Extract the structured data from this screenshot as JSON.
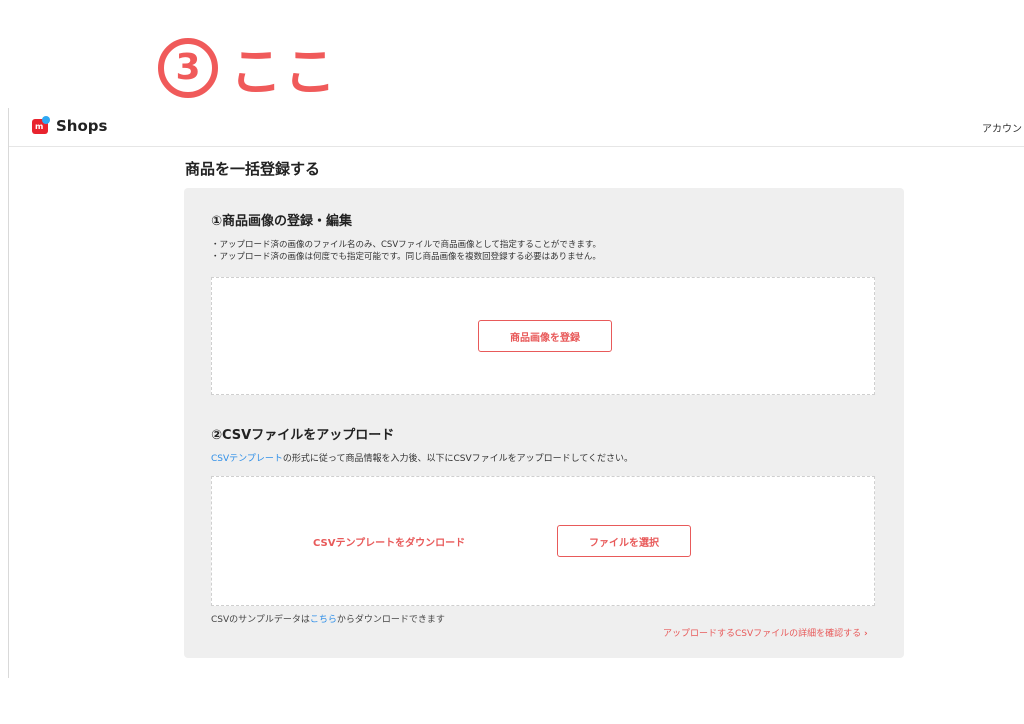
{
  "annotation": {
    "number": "3",
    "text": "ここ"
  },
  "header": {
    "logo_text": "Shops",
    "account_label": "アカウント"
  },
  "page": {
    "title": "商品を一括登録する"
  },
  "section_images": {
    "title": "①商品画像の登録・編集",
    "notes": [
      "・アップロード済の画像のファイル名のみ、CSVファイルで商品画像として指定することができます。",
      "・アップロード済の画像は何度でも指定可能です。同じ商品画像を複数回登録する必要はありません。"
    ],
    "register_button": "商品画像を登録"
  },
  "section_csv": {
    "title": "②CSVファイルをアップロード",
    "description_link": "CSVテンプレート",
    "description_rest": "の形式に従って商品情報を入力後、以下にCSVファイルをアップロードしてください。",
    "download_template_link": "CSVテンプレートをダウンロード",
    "select_file_button": "ファイルを選択",
    "sample_prefix": "CSVのサンプルデータは",
    "sample_link": "こちら",
    "sample_suffix": "からダウンロードできます",
    "detail_link": "アップロードするCSVファイルの詳細を確認する",
    "detail_chevron": "›"
  },
  "colors": {
    "accent": "#e85a5a",
    "annotation": "#f05a5a",
    "link": "#2f8fe8",
    "panel_bg": "#efefef"
  }
}
